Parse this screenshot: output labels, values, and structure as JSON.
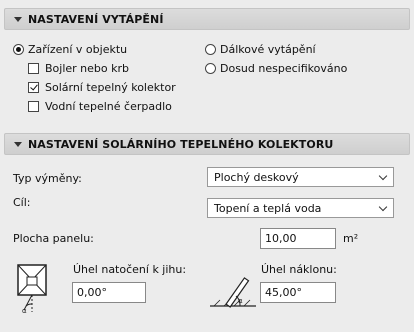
{
  "heating": {
    "header": "NASTAVENÍ VYTÁPĚNÍ",
    "radio_in_building": "Zařízení v objektu",
    "radio_district": "Dálkové vytápění",
    "radio_unspecified": "Dosud nespecifikováno",
    "check_boiler": "Bojler nebo krb",
    "check_solar": "Solární tepelný kolektor",
    "check_heat_pump": "Vodní tepelné čerpadlo",
    "selected_radio": "Zařízení v objektu",
    "checked": {
      "boiler": false,
      "solar": true,
      "heat_pump": false
    }
  },
  "solar": {
    "header": "NASTAVENÍ SOLÁRNÍHO TEPELNÉHO KOLEKTORU",
    "exchange_type_label": "Typ výměny:",
    "exchange_type_value": "Plochý deskový",
    "target_label": "Cíl:",
    "target_value": "Topení a teplá voda",
    "panel_area_label": "Plocha panelu:",
    "panel_area_value": "10,00",
    "panel_area_unit": "m²",
    "rotation_label": "Úhel natočení k jihu:",
    "rotation_value": "0,00°",
    "tilt_label": "Úhel náklonu:",
    "tilt_value": "45,00°"
  },
  "icons": {
    "orientation": "compass-orientation-icon",
    "tilt": "tilt-angle-icon"
  }
}
